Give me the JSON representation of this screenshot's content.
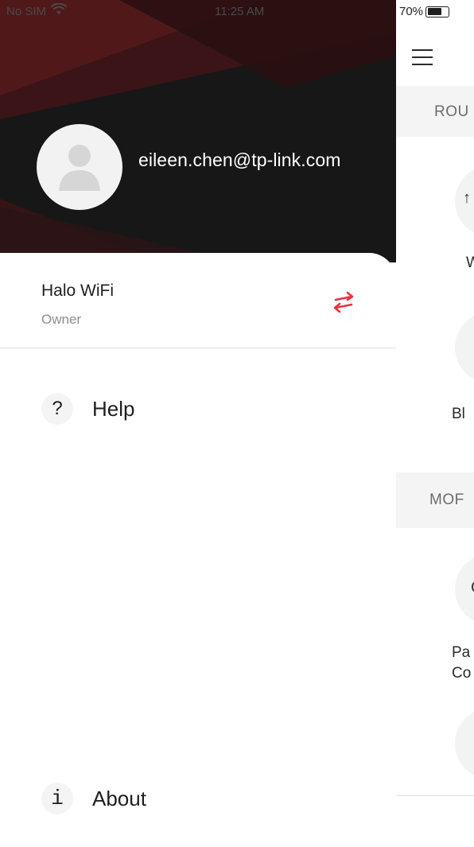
{
  "status_bar": {
    "carrier": "No SIM",
    "time": "11:25 AM",
    "battery": "70%",
    "wifi_icon": "wifi-icon"
  },
  "drawer": {
    "account": {
      "email": "eileen.chen@tp-link.com",
      "avatar_icon": "user-avatar-icon"
    },
    "network": {
      "name": "Halo WiFi",
      "role": "Owner",
      "switch_icon": "swap-arrows-icon",
      "accent_color": "#e8333f"
    },
    "menu": [
      {
        "icon_glyph": "?",
        "icon": "help-icon",
        "label": "Help"
      },
      {
        "icon_glyph": "i",
        "icon": "info-icon",
        "label": "About"
      }
    ]
  },
  "main": {
    "menu_icon": "hamburger-menu-icon",
    "sections": [
      {
        "title": "ROU"
      },
      {
        "title": "MOF"
      }
    ],
    "features": [
      {
        "label": "W",
        "icon_glyph": "↑"
      },
      {
        "label": "Bl",
        "icon_glyph": ""
      },
      {
        "label_line1": "Pa",
        "label_line2": "Co",
        "icon_glyph": "C"
      },
      {
        "label": "",
        "icon_glyph": ""
      }
    ]
  }
}
